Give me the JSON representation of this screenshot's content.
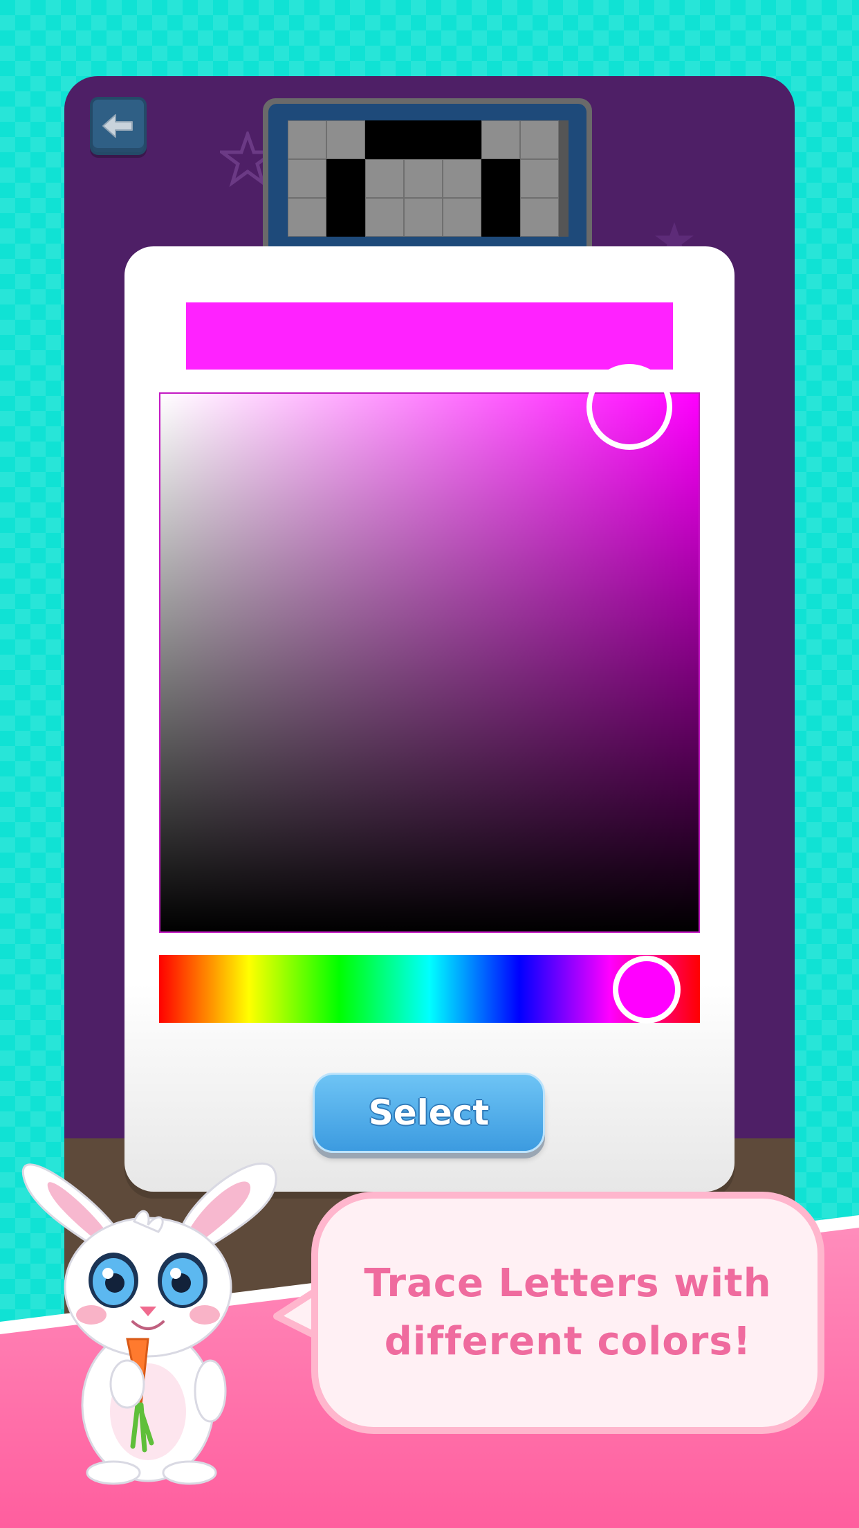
{
  "colors": {
    "selected": "#ff22ff",
    "hue": "#ff00ff",
    "board": "#4e1f66",
    "background": "#10e2d4",
    "banner": "#ff6aa6"
  },
  "toolbar": {
    "back_icon": "arrow-left-icon"
  },
  "letter_grid": {
    "rows": [
      [
        0,
        0,
        1,
        1,
        1,
        0,
        0
      ],
      [
        0,
        1,
        0,
        0,
        0,
        1,
        0
      ],
      [
        0,
        1,
        0,
        0,
        0,
        1,
        0
      ]
    ]
  },
  "color_picker": {
    "saturation": 1.0,
    "value": 1.0,
    "hue_degrees": 300,
    "select_label": "Select"
  },
  "speech": {
    "line1": "Trace Letters with",
    "line2": "different colors!"
  }
}
